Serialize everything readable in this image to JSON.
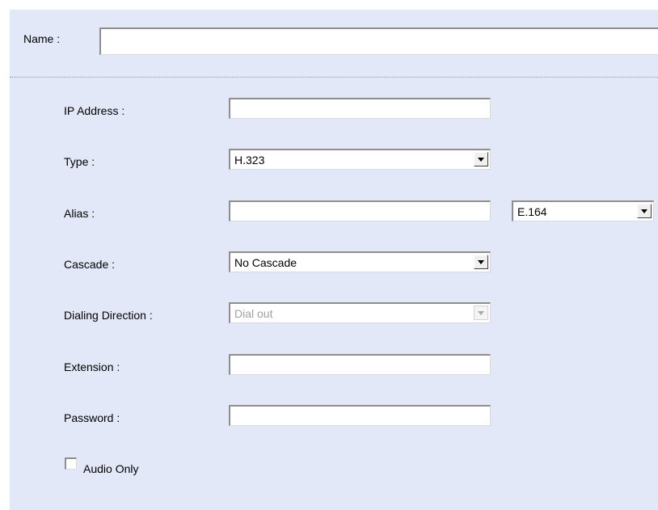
{
  "name_row": {
    "label": "Name :",
    "value": ""
  },
  "fields": {
    "ip_address": {
      "label": "IP Address :",
      "value": ""
    },
    "type": {
      "label": "Type :",
      "selected": "H.323"
    },
    "alias": {
      "label": "Alias :",
      "value": "",
      "format_selected": "E.164"
    },
    "cascade": {
      "label": "Cascade :",
      "selected": "No Cascade"
    },
    "dialing_direction": {
      "label": "Dialing Direction :",
      "selected": "Dial out",
      "disabled": true
    },
    "extension": {
      "label": "Extension :",
      "value": ""
    },
    "password": {
      "label": "Password :",
      "value": ""
    },
    "audio_only": {
      "label": "Audio Only",
      "checked": false
    }
  },
  "icons": {
    "dropdown": "chevron-down-icon"
  },
  "colors": {
    "panel_background": "#e2e8f7",
    "disabled_text": "#a0a0a0"
  }
}
